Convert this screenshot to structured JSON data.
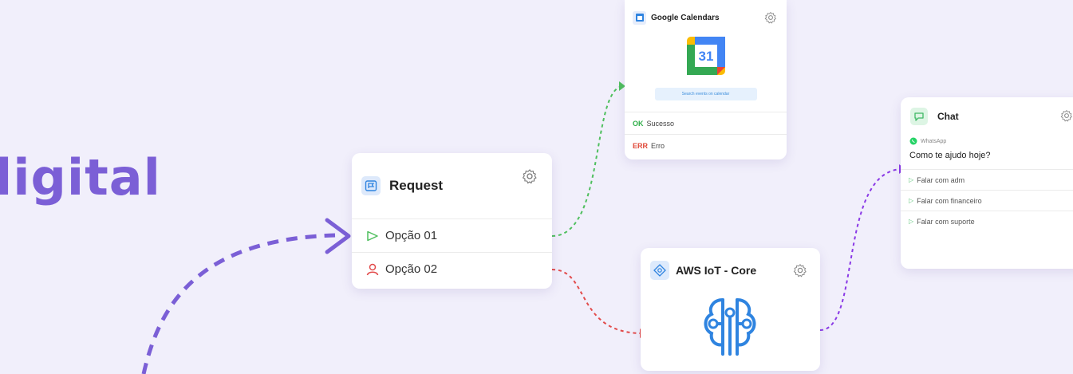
{
  "hero": {
    "text": "ligital"
  },
  "request_node": {
    "title": "Request",
    "options": [
      "Opção 01",
      "Opção 02"
    ]
  },
  "calendar_node": {
    "title": "Google Calendars",
    "logo_number": "31",
    "action_label": "Search events on calendar",
    "outputs": [
      {
        "code": "OK",
        "label": "Sucesso"
      },
      {
        "code": "ERR",
        "label": "Erro"
      }
    ]
  },
  "chat_node": {
    "title": "Chat",
    "channel": "WhatsApp",
    "message": "Como te ajudo hoje?",
    "options": [
      "Falar com adm",
      "Falar com financeiro",
      "Falar com suporte"
    ]
  },
  "aws_node": {
    "title": "AWS IoT - Core"
  },
  "colors": {
    "accent": "#7b5fd6",
    "ok_wire": "#4fbf5e",
    "err_wire": "#e24b4b",
    "aws_wire": "#8a39e6",
    "blue_icon": "#2f84e0"
  },
  "icons": [
    "flag-icon",
    "gear-icon",
    "play-icon",
    "user-icon",
    "calendar-icon",
    "chat-icon",
    "whatsapp-icon",
    "aws-iot-icon"
  ]
}
